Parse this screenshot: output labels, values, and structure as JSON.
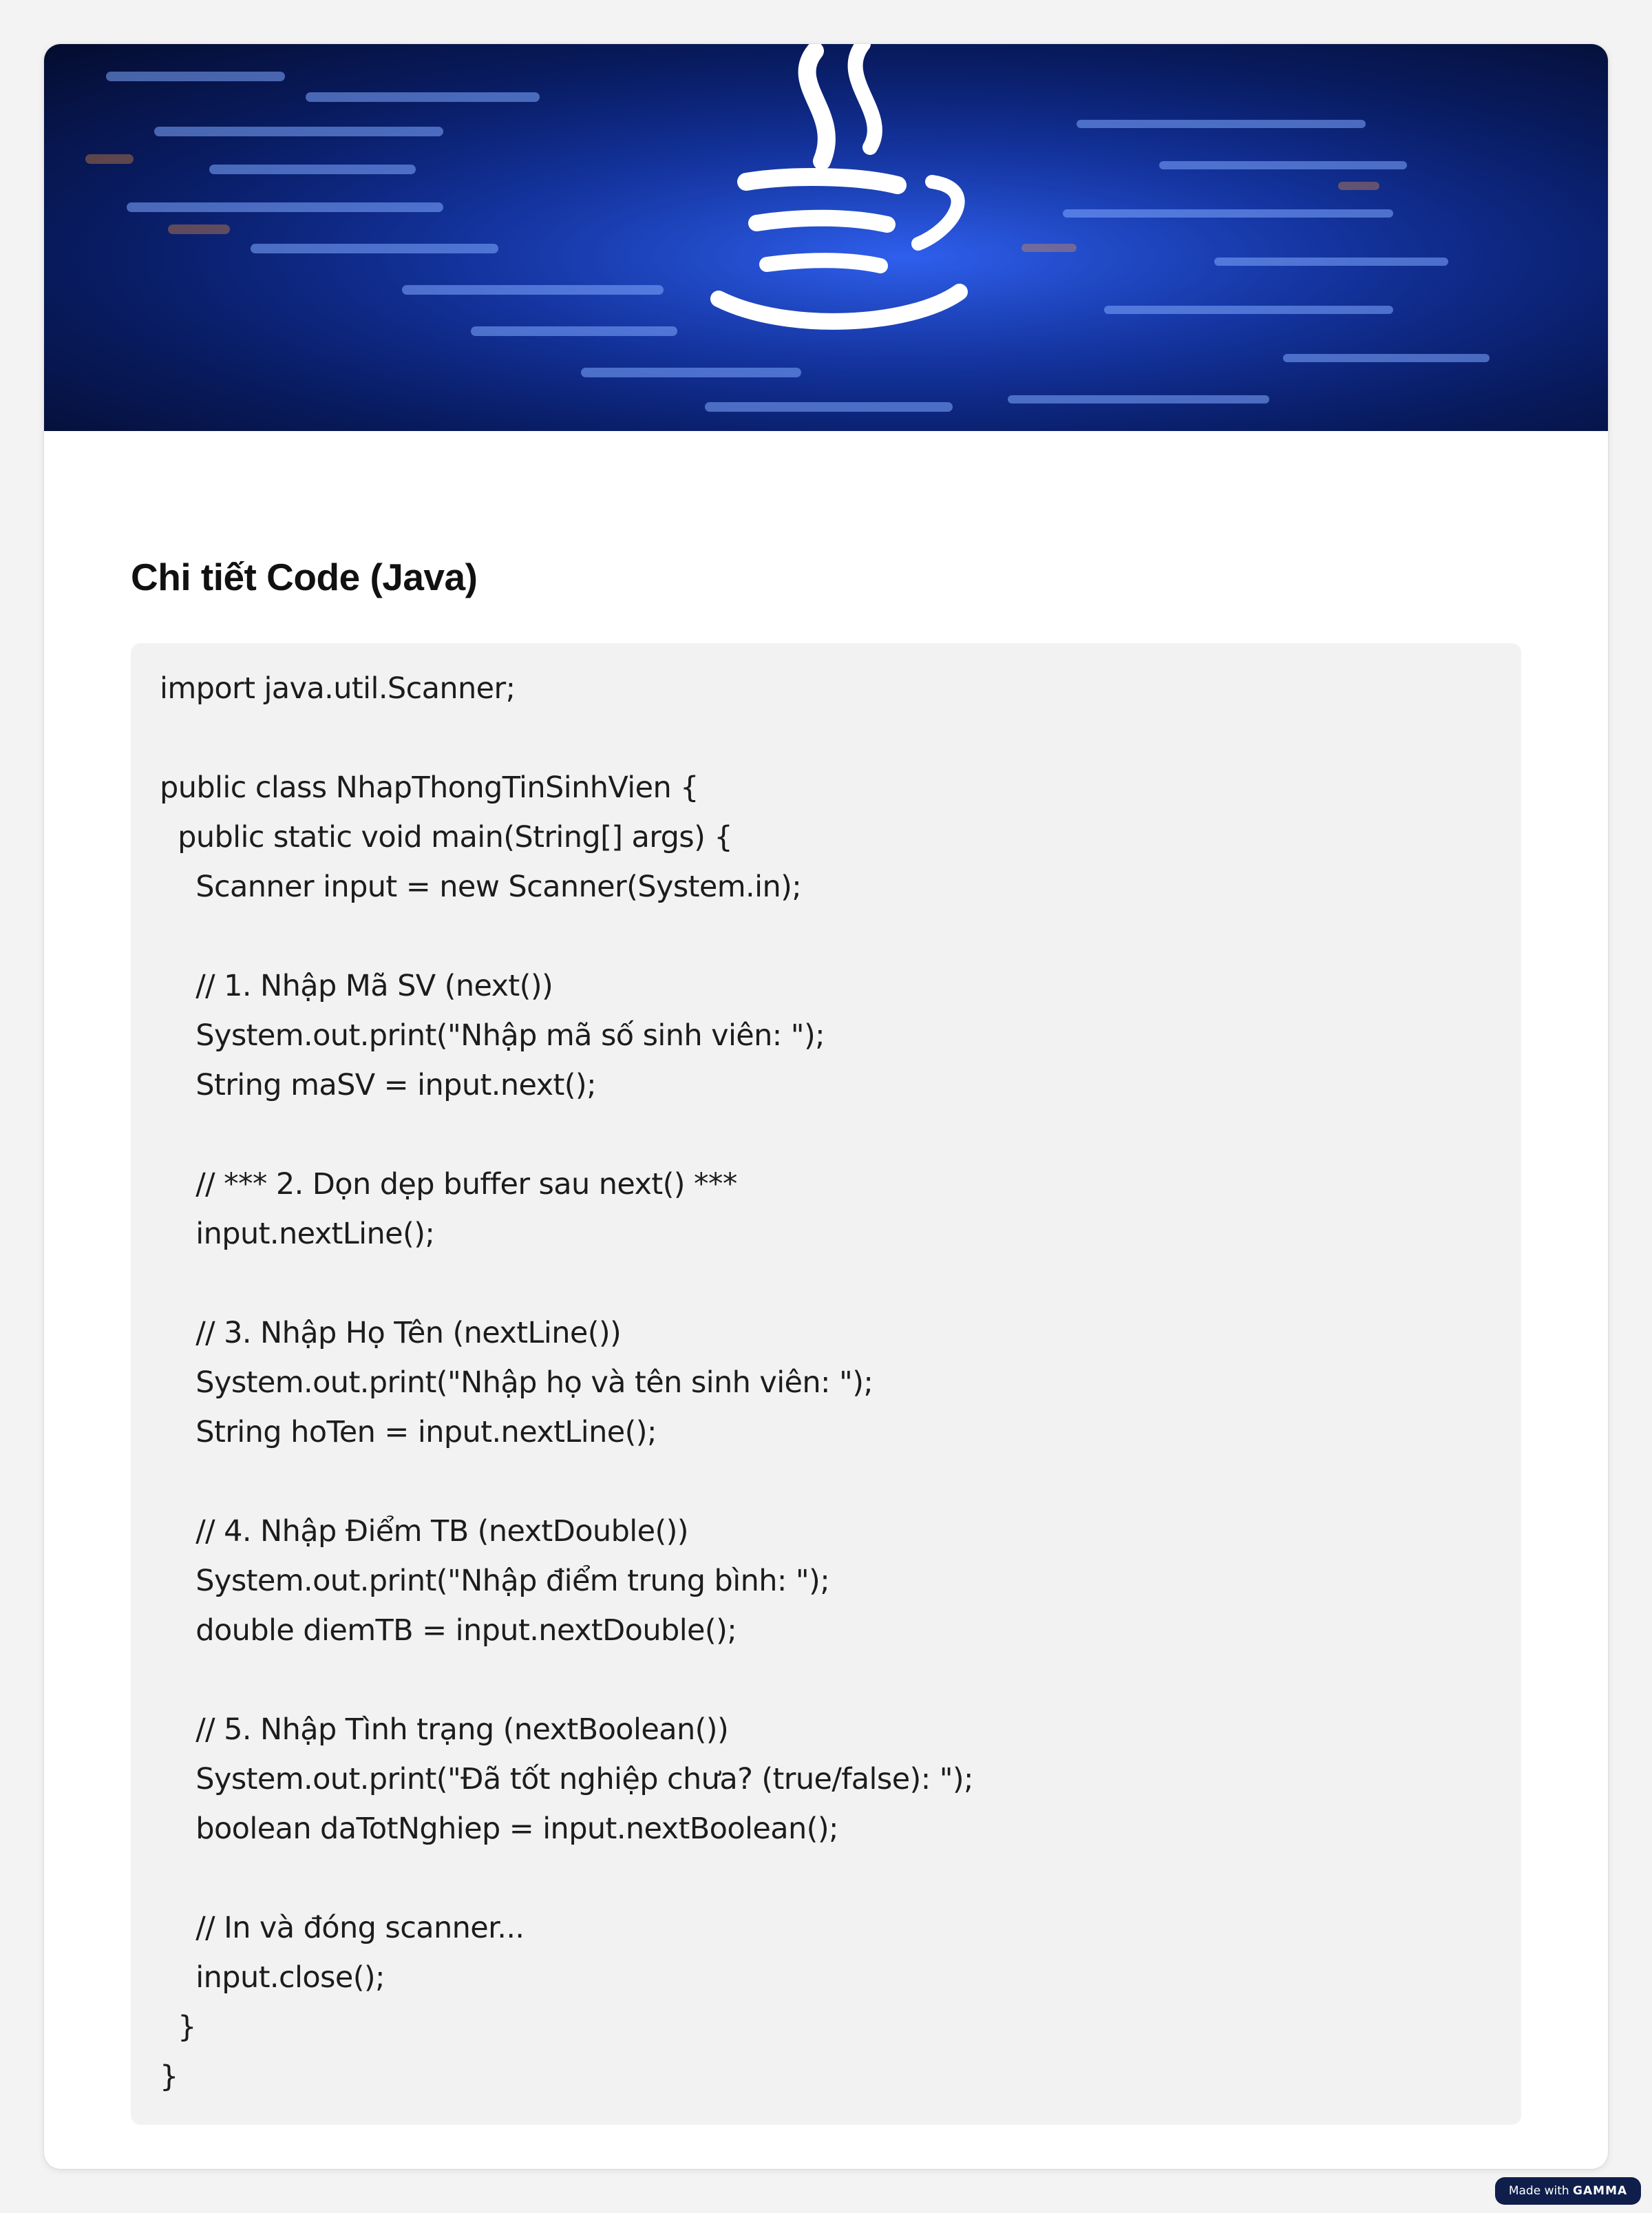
{
  "section": {
    "title": "Chi tiết Code (Java)"
  },
  "code": {
    "lines": [
      "import java.util.Scanner;",
      "",
      "public class NhapThongTinSinhVien {",
      "  public static void main(String[] args) {",
      "    Scanner input = new Scanner(System.in);",
      "",
      "    // 1. Nhập Mã SV (next())",
      "    System.out.print(\"Nhập mã số sinh viên: \");",
      "    String maSV = input.next();",
      "",
      "    // *** 2. Dọn dẹp buffer sau next() ***",
      "    input.nextLine();",
      "",
      "    // 3. Nhập Họ Tên (nextLine())",
      "    System.out.print(\"Nhập họ và tên sinh viên: \");",
      "    String hoTen = input.nextLine();",
      "",
      "    // 4. Nhập Điểm TB (nextDouble())",
      "    System.out.print(\"Nhập điểm trung bình: \");",
      "    double diemTB = input.nextDouble();",
      "",
      "    // 5. Nhập Tình trạng (nextBoolean())",
      "    System.out.print(\"Đã tốt nghiệp chưa? (true/false): \");",
      "    boolean daTotNghiep = input.nextBoolean();",
      "",
      "    // In và đóng scanner...",
      "    input.close();",
      "  }",
      "}"
    ]
  },
  "badge": {
    "prefix": "Made with",
    "brand": "GAMMA"
  },
  "colors": {
    "page_background": "#f4f3f3",
    "card_background": "#ffffff",
    "code_background": "#f2f2f2",
    "hero_blue": "#1f4fd8",
    "badge_background": "#0f1e4a"
  },
  "icons": {
    "hero": "java-coffee-cup-icon"
  }
}
